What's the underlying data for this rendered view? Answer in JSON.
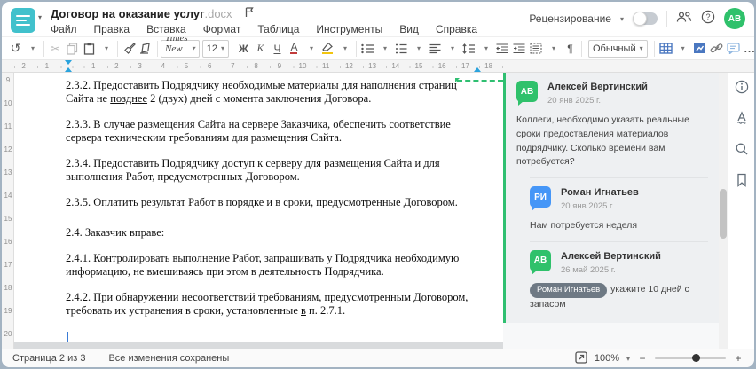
{
  "window": {
    "title": "Договор на оказание услуг",
    "title_ext": ".docx"
  },
  "menu": {
    "items": [
      "Файл",
      "Правка",
      "Вставка",
      "Формат",
      "Таблица",
      "Инструменты",
      "Вид",
      "Справка"
    ]
  },
  "header_right": {
    "review_label": "Рецензирование",
    "avatar_initials": "АВ"
  },
  "toolbar": {
    "font_name": "Times New ...",
    "font_size": "12",
    "bold_label": "Ж",
    "italic_label": "К",
    "underline_label": "Ч",
    "font_color_label": "А",
    "paragraph_mark": "¶",
    "style_name": "Обычный",
    "more_label": "..."
  },
  "ruler": {
    "h_left": [
      "2",
      "1"
    ],
    "h_right": [
      "1",
      "2",
      "3",
      "4",
      "5",
      "6",
      "7",
      "8",
      "9",
      "10",
      "11",
      "12",
      "13",
      "14",
      "15",
      "16",
      "17",
      "18"
    ],
    "v_numbers": [
      "9",
      "10",
      "11",
      "12",
      "13",
      "14",
      "15",
      "16",
      "17",
      "18",
      "19",
      "20"
    ]
  },
  "document": {
    "paragraphs": [
      {
        "segments": [
          {
            "t": "2.3.2. Предоставить Подрядчику необходимые материалы для наполнения страниц Сайта не "
          },
          {
            "t": "позднее",
            "u": true
          },
          {
            "t": " 2 (двух) дней с момента заключения Договора."
          }
        ]
      },
      {
        "segments": [
          {
            "t": "2.3.3. В случае размещения Сайта на сервере Заказчика, обеспечить соответствие сервера техническим требованиям для размещения Сайта."
          }
        ]
      },
      {
        "segments": [
          {
            "t": "2.3.4. Предоставить Подрядчику доступ к серверу для размещения Сайта и для выполнения Работ, предусмотренных Договором."
          }
        ]
      },
      {
        "segments": [
          {
            "t": "2.3.5. Оплатить результат Работ в порядке и в сроки, предусмотренные Договором."
          }
        ]
      },
      {
        "big_gap": true,
        "segments": [
          {
            "t": "2.4. Заказчик вправе:"
          }
        ]
      },
      {
        "segments": [
          {
            "t": "2.4.1. Контролировать выполнение Работ, запрашивать у Подрядчика необходимую информацию, не вмешиваясь при этом в деятельность Подрядчика."
          }
        ]
      },
      {
        "segments": [
          {
            "t": "2.4.2. При обнаружении несоответствий требованиям, предусмотренным Договором, требовать их устранения в сроки, установленные "
          },
          {
            "t": "в",
            "u": true
          },
          {
            "t": " п. 2.7.1."
          }
        ]
      }
    ]
  },
  "comments": {
    "thread": [
      {
        "initials": "АВ",
        "color": "green",
        "name": "Алексей Вертинский",
        "date": "20 янв 2025 г.",
        "text": "Коллеги, необходимо указать реальные сроки предоставления материалов подрядчику. Сколько времени вам потребуется?"
      },
      {
        "initials": "РИ",
        "color": "blue",
        "name": "Роман Игнатьев",
        "date": "20 янв 2025 г.",
        "text": "Нам потребуется неделя",
        "reply": true
      },
      {
        "initials": "АВ",
        "color": "green",
        "name": "Алексей Вертинский",
        "date": "26 май 2025 г.",
        "mention": "Роман Игнатьев",
        "text": "укажите 10 дней с запасом",
        "reply": true
      }
    ]
  },
  "status_bar": {
    "page_info": "Страница 2 из 3",
    "save_status": "Все изменения сохранены",
    "zoom_level": "100%"
  },
  "colors": {
    "accent_teal": "#41c1cc",
    "accent_green": "#2fc16b",
    "accent_blue_avatar": "#4596f7",
    "toolbar_blue": "#4a77c0",
    "indent_marker_blue": "#2aa3dd"
  }
}
